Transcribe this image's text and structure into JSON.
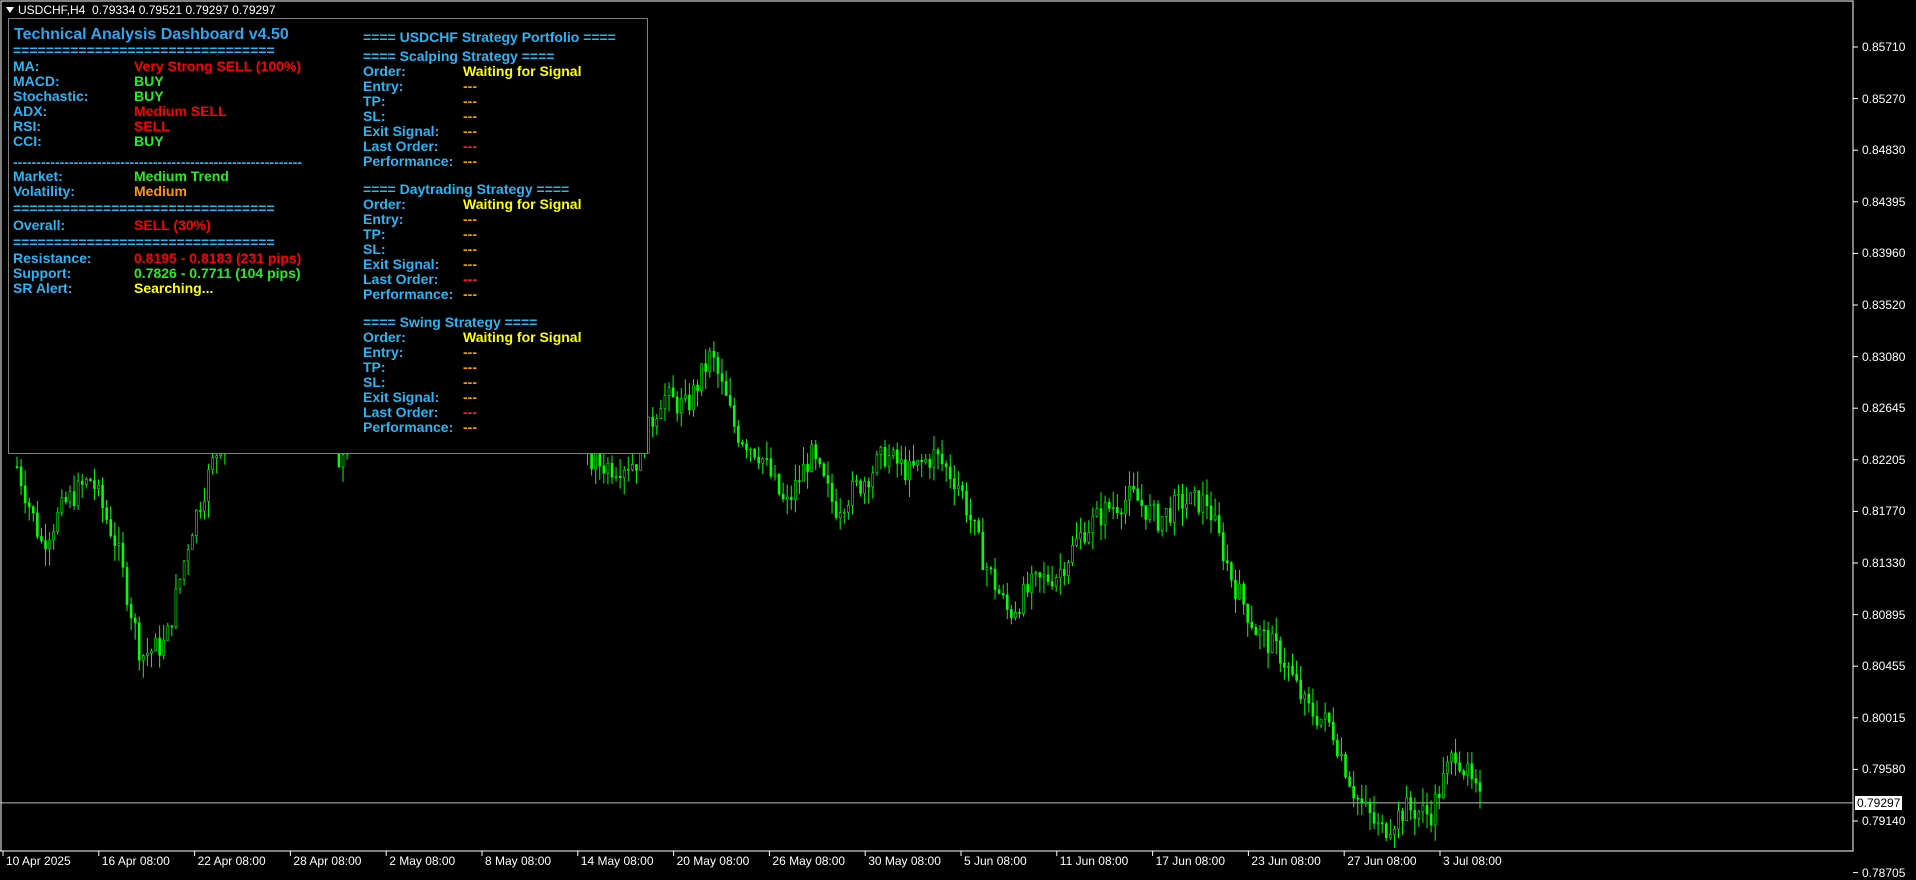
{
  "header": {
    "symbol": "USDCHF,H4",
    "ohlc": "0.79334 0.79521 0.79297 0.79297"
  },
  "y_axis": {
    "labels": [
      "0.85710",
      "0.85270",
      "0.84830",
      "0.84395",
      "0.83960",
      "0.83520",
      "0.83080",
      "0.82645",
      "0.82205",
      "0.81770",
      "0.81330",
      "0.80895",
      "0.80455",
      "0.80015",
      "0.79580",
      "0.79140",
      "0.78705"
    ],
    "current_price": "0.79297"
  },
  "x_axis": {
    "labels": [
      "10 Apr 2025",
      "16 Apr 08:00",
      "22 Apr 08:00",
      "28 Apr 08:00",
      "2 May 08:00",
      "8 May 08:00",
      "14 May 08:00",
      "20 May 08:00",
      "26 May 08:00",
      "30 May 08:00",
      "5 Jun 08:00",
      "11 Jun 08:00",
      "17 Jun 08:00",
      "23 Jun 08:00",
      "27 Jun 08:00",
      "3 Jul 08:00"
    ]
  },
  "colors": {
    "bull": "#00ff00",
    "bear": "#00ff00",
    "background": "#000000",
    "label": "#29b6f6",
    "sell": "#ff0000",
    "buy": "#22ee22",
    "signal": "#ffff00"
  },
  "chart_data": {
    "type": "candlestick",
    "symbol": "USDCHF",
    "timeframe": "H4",
    "current_price": 0.79297,
    "open": 0.79334,
    "high": 0.79521,
    "low": 0.79297,
    "close": 0.79297,
    "ylim": [
      0.7855,
      0.8585
    ],
    "anchors": [
      {
        "date": "10 Apr 2025",
        "price": 0.8215
      },
      {
        "date": "12 Apr",
        "price": 0.815
      },
      {
        "date": "14 Apr",
        "price": 0.8185
      },
      {
        "date": "16 Apr",
        "price": 0.8205
      },
      {
        "date": "18 Apr",
        "price": 0.815
      },
      {
        "date": "20 Apr",
        "price": 0.8055
      },
      {
        "date": "21 Apr",
        "price": 0.8065
      },
      {
        "date": "22 Apr",
        "price": 0.816
      },
      {
        "date": "24 Apr",
        "price": 0.8225
      },
      {
        "date": "26 Apr",
        "price": 0.827
      },
      {
        "date": "28 Apr",
        "price": 0.8265
      },
      {
        "date": "30 Apr",
        "price": 0.827
      },
      {
        "date": "2 May",
        "price": 0.827
      },
      {
        "date": "5 May",
        "price": 0.822
      },
      {
        "date": "8 May",
        "price": 0.831
      },
      {
        "date": "10 May",
        "price": 0.8335
      },
      {
        "date": "12 May",
        "price": 0.837
      },
      {
        "date": "13 May",
        "price": 0.835
      },
      {
        "date": "15 May",
        "price": 0.835
      },
      {
        "date": "17 May",
        "price": 0.834
      },
      {
        "date": "18 May",
        "price": 0.829
      },
      {
        "date": "19 May",
        "price": 0.8255
      },
      {
        "date": "21 May",
        "price": 0.829
      },
      {
        "date": "22 May",
        "price": 0.822
      },
      {
        "date": "23 May",
        "price": 0.8215
      },
      {
        "date": "24 May",
        "price": 0.822
      },
      {
        "date": "26 May",
        "price": 0.8275
      },
      {
        "date": "28 May",
        "price": 0.8265
      },
      {
        "date": "29 May",
        "price": 0.831
      },
      {
        "date": "30 May",
        "price": 0.8245
      },
      {
        "date": "31 May",
        "price": 0.8225
      },
      {
        "date": "1 Jun",
        "price": 0.818
      },
      {
        "date": "3 Jun",
        "price": 0.8225
      },
      {
        "date": "4 Jun",
        "price": 0.818
      },
      {
        "date": "5 Jun",
        "price": 0.82
      },
      {
        "date": "6 Jun",
        "price": 0.8225
      },
      {
        "date": "8 Jun",
        "price": 0.821
      },
      {
        "date": "9 Jun",
        "price": 0.8225
      },
      {
        "date": "10 Jun",
        "price": 0.82
      },
      {
        "date": "11 Jun",
        "price": 0.8135
      },
      {
        "date": "12 Jun",
        "price": 0.809
      },
      {
        "date": "13 Jun",
        "price": 0.8115
      },
      {
        "date": "14 Jun",
        "price": 0.8125
      },
      {
        "date": "15 Jun",
        "price": 0.816
      },
      {
        "date": "17 Jun",
        "price": 0.818
      },
      {
        "date": "18 Jun",
        "price": 0.819
      },
      {
        "date": "19 Jun",
        "price": 0.817
      },
      {
        "date": "20 Jun",
        "price": 0.8185
      },
      {
        "date": "22 Jun",
        "price": 0.8185
      },
      {
        "date": "23 Jun",
        "price": 0.812
      },
      {
        "date": "24 Jun",
        "price": 0.8075
      },
      {
        "date": "25 Jun",
        "price": 0.8055
      },
      {
        "date": "26 Jun",
        "price": 0.801
      },
      {
        "date": "27 Jun",
        "price": 0.7995
      },
      {
        "date": "28 Jun",
        "price": 0.7935
      },
      {
        "date": "29 Jun",
        "price": 0.7905
      },
      {
        "date": "1 Jul",
        "price": 0.7925
      },
      {
        "date": "2 Jul",
        "price": 0.792
      },
      {
        "date": "3 Jul",
        "price": 0.7975
      },
      {
        "date": "4 Jul",
        "price": 0.793
      }
    ]
  },
  "dashboard": {
    "title": "Technical Analysis Dashboard v4.50",
    "sep_eq": "================================",
    "sep_dash": "--------------------------------------------------------------",
    "rows": [
      {
        "label": "MA:",
        "value": "Very Strong SELL (100%)",
        "color": "c-red"
      },
      {
        "label": "MACD:",
        "value": "BUY",
        "color": "c-green"
      },
      {
        "label": "Stochastic:",
        "value": "BUY",
        "color": "c-green"
      },
      {
        "label": "ADX:",
        "value": "Medium SELL",
        "color": "c-red"
      },
      {
        "label": "RSI:",
        "value": "SELL",
        "color": "c-red"
      },
      {
        "label": "CCI:",
        "value": "BUY",
        "color": "c-green"
      }
    ],
    "market": {
      "label": "Market:",
      "value": "Medium Trend"
    },
    "volatility": {
      "label": "Volatility:",
      "value": "Medium"
    },
    "overall": {
      "label": "Overall:",
      "value": "SELL (30%)"
    },
    "resistance": {
      "label": "Resistance:",
      "value": "0.8195 - 0.8183 (231 pips)"
    },
    "support": {
      "label": "Support:",
      "value": "0.7826 - 0.7711 (104 pips)"
    },
    "sr_alert": {
      "label": "SR Alert:",
      "value": "Searching..."
    }
  },
  "portfolio": {
    "title": "==== USDCHF Strategy Portfolio ====",
    "strategies": [
      {
        "name": "==== Scalping Strategy ===="
      },
      {
        "name": "==== Daytrading Strategy ===="
      },
      {
        "name": "==== Swing Strategy ===="
      }
    ],
    "fields": {
      "order": "Order:",
      "entry": "Entry:",
      "tp": "TP:",
      "sl": "SL:",
      "exit": "Exit Signal:",
      "last": "Last Order:",
      "perf": "Performance:"
    },
    "order_value": "Waiting for Signal",
    "empty_value": "---"
  }
}
